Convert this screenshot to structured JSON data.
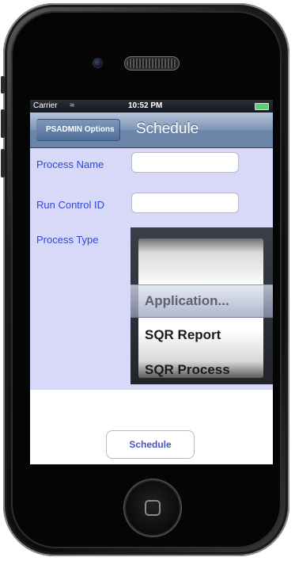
{
  "status": {
    "carrier": "Carrier",
    "time": "10:52 PM"
  },
  "navbar": {
    "back_label": "PSADMIN Options",
    "title": "Schedule"
  },
  "form": {
    "process_name_label": "Process Name",
    "process_name_value": "",
    "run_control_label": "Run Control ID",
    "run_control_value": "",
    "process_type_label": "Process Type"
  },
  "picker": {
    "selected": "Application...",
    "options": [
      "SQR Report",
      "SQR Process"
    ]
  },
  "schedule_button": "Schedule",
  "icons": {
    "wifi": "wifi-icon",
    "battery": "battery-icon",
    "home": "home-button-icon",
    "back": "chevron-left-icon"
  }
}
